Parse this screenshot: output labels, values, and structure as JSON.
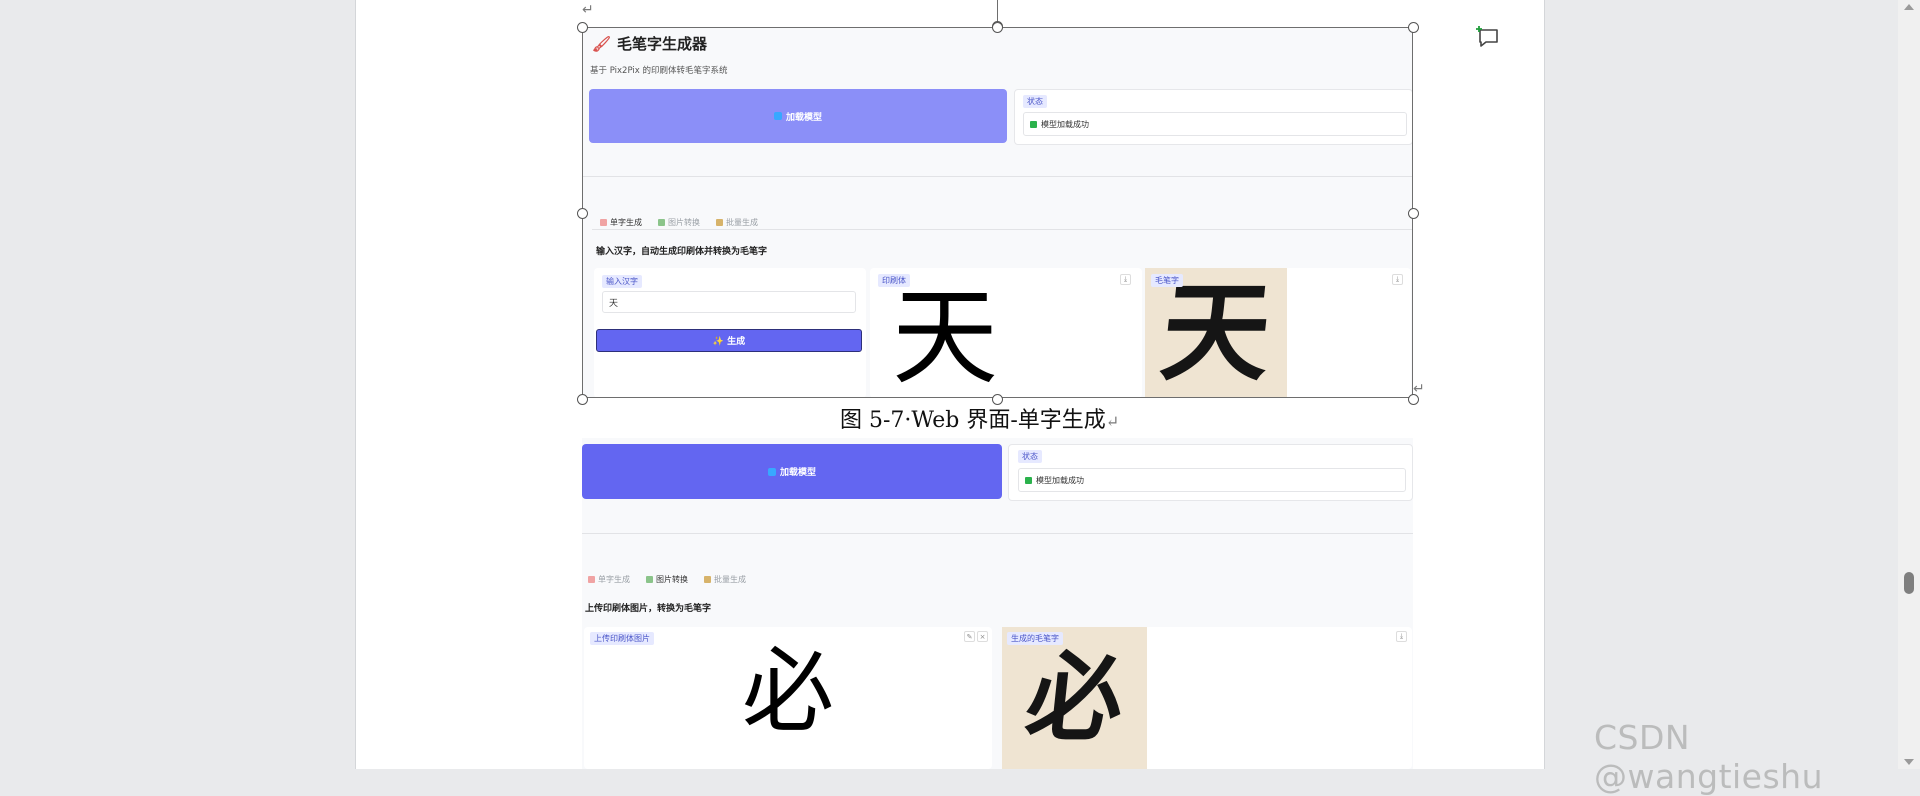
{
  "document": {
    "paragraph_mark": "↵",
    "caption": "图 5-7·Web 界面-单字生成",
    "caption_return": "↵"
  },
  "shot1": {
    "app_title": "毛笔字生成器",
    "app_subtitle": "基于 Pix2Pix 的印刷体转毛笔字系统",
    "load_model_label": "加载模型",
    "status_tag": "状态",
    "status_text": "模型加载成功",
    "tabs": [
      "单字生成",
      "图片转换",
      "批量生成"
    ],
    "active_tab": "单字生成",
    "section_title": "输入汉字，自动生成印刷体并转换为毛笔字",
    "input_tag": "输入汉字",
    "input_value": "天",
    "generate_label": "✨ 生成",
    "print_panel_tag": "印刷体",
    "brush_panel_tag": "毛笔字",
    "print_char": "天",
    "brush_char": "天"
  },
  "shot2": {
    "load_model_label": "加载模型",
    "status_tag": "状态",
    "status_text": "模型加载成功",
    "tabs": [
      "单字生成",
      "图片转换",
      "批量生成"
    ],
    "active_tab": "图片转换",
    "section_title": "上传印刷体图片，转换为毛笔字",
    "upload_tag": "上传印刷体图片",
    "result_tag": "生成的毛笔字",
    "print_char": "必",
    "brush_char": "必"
  },
  "watermark": "CSDN @wangtieshu",
  "colors": {
    "accent": "#6366f1",
    "accent_light": "#8b8ff8",
    "success": "#2bb24c",
    "paper": "#efe4d2"
  }
}
